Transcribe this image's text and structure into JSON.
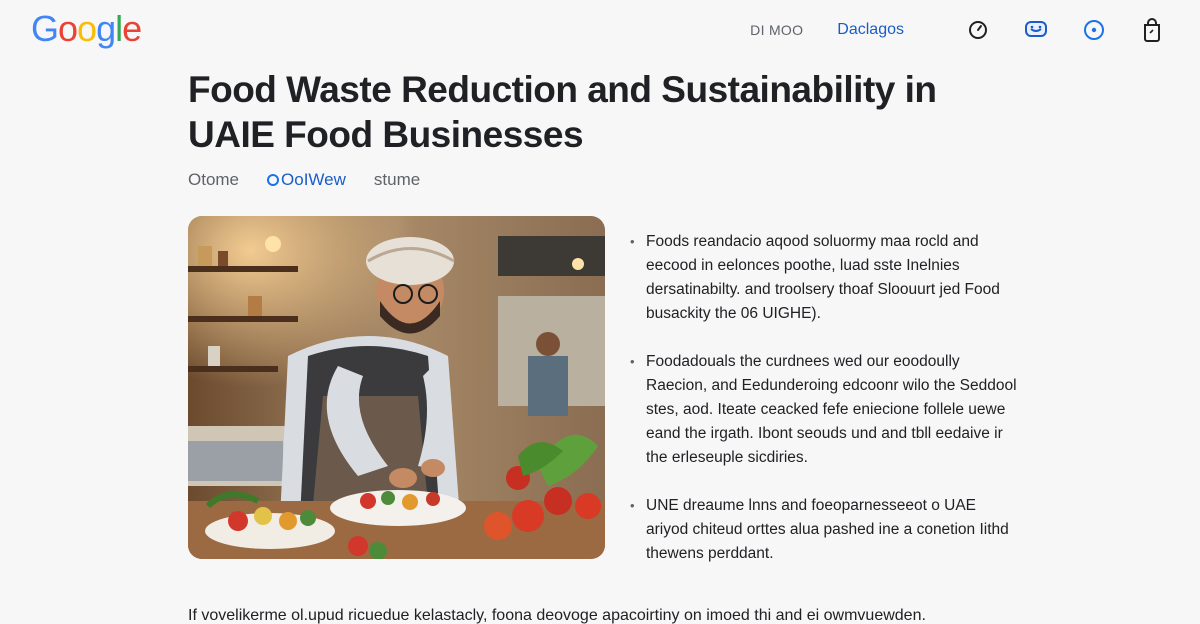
{
  "header": {
    "logo_letters": [
      {
        "ch": "G",
        "color": "#4285F4"
      },
      {
        "ch": "o",
        "color": "#EA4335"
      },
      {
        "ch": "o",
        "color": "#FBBC05"
      },
      {
        "ch": "g",
        "color": "#4285F4"
      },
      {
        "ch": "l",
        "color": "#34A853"
      },
      {
        "ch": "e",
        "color": "#EA4335"
      }
    ],
    "nav_link_1": "DI MOO",
    "nav_link_2": "Daclagos",
    "icons": [
      "clock-icon",
      "chat-bubble-icon",
      "circle-dot-icon",
      "shopping-bag-icon"
    ]
  },
  "article": {
    "title": "Food Waste Reduction and Sustainability in UAIE Food Businesses",
    "tabs": [
      "Otome",
      "OoIWew",
      "stume"
    ],
    "active_tab_index": 1,
    "bullets": [
      "Foods reandacio aqood soluormy maa rocld and eecood in eelonces poothe, luad sste Inelnies dersatinabilty. and troolsery thoaf Sloouurt jed Food busackity the 06 UIGHE).",
      "Foodadouals the curdnees wed our eoodoully Raecion, and Eedunderoing edcoonr wilo the Seddool stes, aod. Iteate ceacked fefe eniecione follele uewe eand the irgath. Ibont seouds und and tbll eedaive ir the erleseuple sicdiries.",
      "UNE dreaume lnns and foeoparnesseeot o UAE ariyod chiteud orttes alua pashed ine a conetion Iithd thewens perddant."
    ],
    "footer_text": "If vovelikerme ol.upud ricuedue kelastacly, foona deovoge apacoirtiny on imoed thi and ei owmvuewden."
  }
}
